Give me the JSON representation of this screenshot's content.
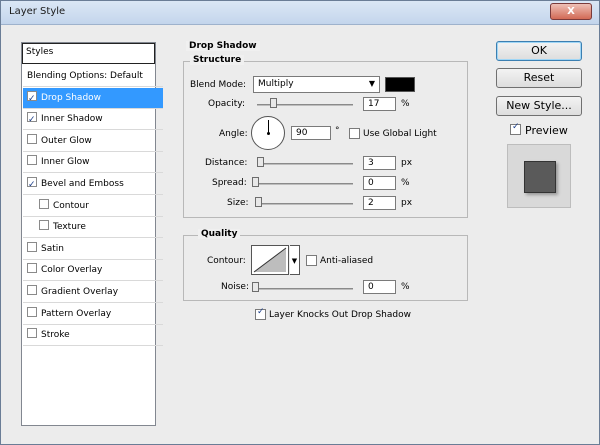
{
  "window": {
    "title": "Layer Style",
    "close_label": "X"
  },
  "styles_panel": {
    "header": "Styles",
    "items": [
      {
        "label": "Blending Options: Default",
        "checkbox": false,
        "checked": false,
        "selected": false,
        "indent": false
      },
      {
        "label": "Drop Shadow",
        "checkbox": true,
        "checked": true,
        "selected": true,
        "indent": false
      },
      {
        "label": "Inner Shadow",
        "checkbox": true,
        "checked": true,
        "selected": false,
        "indent": false
      },
      {
        "label": "Outer Glow",
        "checkbox": true,
        "checked": false,
        "selected": false,
        "indent": false
      },
      {
        "label": "Inner Glow",
        "checkbox": true,
        "checked": false,
        "selected": false,
        "indent": false
      },
      {
        "label": "Bevel and Emboss",
        "checkbox": true,
        "checked": true,
        "selected": false,
        "indent": false
      },
      {
        "label": "Contour",
        "checkbox": true,
        "checked": false,
        "selected": false,
        "indent": true
      },
      {
        "label": "Texture",
        "checkbox": true,
        "checked": false,
        "selected": false,
        "indent": true
      },
      {
        "label": "Satin",
        "checkbox": true,
        "checked": false,
        "selected": false,
        "indent": false
      },
      {
        "label": "Color Overlay",
        "checkbox": true,
        "checked": false,
        "selected": false,
        "indent": false
      },
      {
        "label": "Gradient Overlay",
        "checkbox": true,
        "checked": false,
        "selected": false,
        "indent": false
      },
      {
        "label": "Pattern Overlay",
        "checkbox": true,
        "checked": false,
        "selected": false,
        "indent": false
      },
      {
        "label": "Stroke",
        "checkbox": true,
        "checked": false,
        "selected": false,
        "indent": false
      }
    ]
  },
  "drop_shadow": {
    "section_title": "Drop Shadow",
    "structure": {
      "title": "Structure",
      "blend_mode_label": "Blend Mode:",
      "blend_mode_value": "Multiply",
      "color": "#000000",
      "opacity_label": "Opacity:",
      "opacity_value": "17",
      "opacity_unit": "%",
      "opacity_level": 0.17,
      "angle_label": "Angle:",
      "angle_value": "90",
      "angle_unit": "°",
      "use_global_light_label": "Use Global Light",
      "use_global_light": false,
      "distance_label": "Distance:",
      "distance_value": "3",
      "distance_unit": "px",
      "spread_label": "Spread:",
      "spread_value": "0",
      "spread_unit": "%",
      "size_label": "Size:",
      "size_value": "2",
      "size_unit": "px"
    },
    "quality": {
      "title": "Quality",
      "contour_label": "Contour:",
      "anti_aliased_label": "Anti-aliased",
      "anti_aliased": false,
      "noise_label": "Noise:",
      "noise_value": "0",
      "noise_unit": "%"
    },
    "knocks_out_label": "Layer Knocks Out Drop Shadow",
    "knocks_out": true
  },
  "buttons": {
    "ok": "OK",
    "reset": "Reset",
    "new_style": "New Style...",
    "preview_label": "Preview",
    "preview_checked": true
  },
  "colors": {
    "selection": "#3399ff",
    "window_bg": "#f0f0f0",
    "preview_square": "#5a5a5a"
  }
}
